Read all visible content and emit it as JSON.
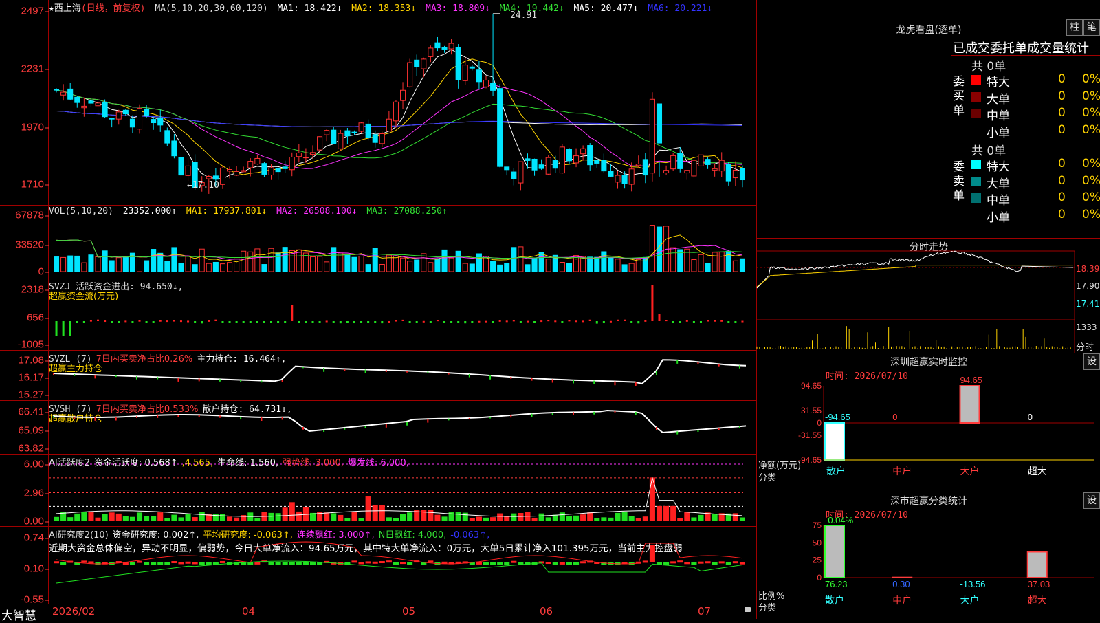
{
  "app": {
    "name": "大智慧"
  },
  "main": {
    "title": "★西上海",
    "period": "(日线，前复权)",
    "ma_label": "MA(5,10,20,30,60,120)",
    "ma": [
      {
        "label": "MA1: 18.422↓",
        "color": "#ffffff"
      },
      {
        "label": "MA2: 18.353↓",
        "color": "#ffd400"
      },
      {
        "label": "MA3: 18.809↓",
        "color": "#ff33ff"
      },
      {
        "label": "MA4: 19.442↓",
        "color": "#33dd33"
      },
      {
        "label": "MA5: 20.477↓",
        "color": "#ffffff"
      },
      {
        "label": "MA6: 20.221↓",
        "color": "#3333ff"
      }
    ],
    "yticks": [
      "2497",
      "2231",
      "1970",
      "1710"
    ],
    "high_label": "24.91",
    "low_label": "←17.10"
  },
  "vol": {
    "label": "VOL(5,10,20)",
    "value": "23352.000↑",
    "ma": [
      {
        "label": "MA1: 17937.801↓",
        "color": "#ffd400"
      },
      {
        "label": "MA2: 26508.100↓",
        "color": "#ff33ff"
      },
      {
        "label": "MA3: 27088.250↑",
        "color": "#33dd33"
      }
    ],
    "yticks": [
      "67878",
      "33520",
      "0"
    ]
  },
  "svzj": {
    "label": "SVZJ  活跃资金进出: 94.650↓,",
    "sub": "超赢资金流(万元)",
    "yticks": [
      "2318",
      "656",
      "-1005"
    ]
  },
  "svzl": {
    "label": "SVZL (7)",
    "red_text": "7日内买卖净占比0.26%",
    "main_text": "主力持仓: 16.464↑,",
    "sub": "超赢主力持仓",
    "yticks": [
      "17.08",
      "16.17",
      "15.27"
    ]
  },
  "svsh": {
    "label": "SVSH (7)",
    "red_text": "7日内买卖净占比0.533%",
    "main_text": "散户持仓: 64.731↓,",
    "sub": "超赢散户持仓",
    "yticks": [
      "66.41",
      "65.09",
      "63.82"
    ]
  },
  "ai1": {
    "label": "AI活跃度2",
    "t1": "资金活跃度: 0.568↑",
    "t2": ",4.565,",
    "t3": "生命线: 1.560,",
    "t4": "强势线: 3.000,",
    "t5": "爆发线: 6.000,",
    "yticks": [
      "6.00",
      "2.96",
      "0.00"
    ]
  },
  "ai2": {
    "label": "AI研究度2(10)",
    "t1": "资金研究度: 0.002↑,",
    "t2": "平均研究度: -0.063↑,",
    "t3": "连续飘红: 3.000↑,",
    "t4": "N日飘红: 4.000,",
    "t5": "-0.063↑,",
    "comment": "近期大资金总体偏空，异动不明显，偏弱势，今日大单净流入：94.65万元，其中特大单净流入：0万元，大单5日累计净入101.395万元，当前主力控盘弱",
    "yticks": [
      "0.74",
      "0.10",
      "-0.55"
    ]
  },
  "xaxis": {
    "labels": [
      "2026/02",
      "04",
      "05",
      "06",
      "07"
    ]
  },
  "dragon": {
    "title": "龙虎看盘(逐单)",
    "btn1": "柱",
    "btn2": "笔",
    "subtitle": "已成交委托单成交量统计",
    "buy_label": "委买单",
    "sell_label": "委卖单",
    "buy_total": "共 0单",
    "sell_total": "共 0单",
    "buy_rows": [
      {
        "name": "特大",
        "count": "0",
        "pct": "0%",
        "color": "#ff0000"
      },
      {
        "name": "大单",
        "count": "0",
        "pct": "0%",
        "color": "#8b0000"
      },
      {
        "name": "中单",
        "count": "0",
        "pct": "0%",
        "color": "#6b0000"
      },
      {
        "name": "小单",
        "count": "0",
        "pct": "0%",
        "color": "#000000"
      }
    ],
    "sell_rows": [
      {
        "name": "特大",
        "count": "0",
        "pct": "0%",
        "color": "#00ffff"
      },
      {
        "name": "大单",
        "count": "0",
        "pct": "0%",
        "color": "#008b8b"
      },
      {
        "name": "中单",
        "count": "0",
        "pct": "0%",
        "color": "#007070"
      },
      {
        "name": "小单",
        "count": "0",
        "pct": "0%",
        "color": "#000000"
      }
    ]
  },
  "intraday": {
    "title": "分时走势",
    "yticks": [
      "18.39",
      "17.90",
      "17.41"
    ],
    "vol_label": "1333",
    "unit_label": "分时"
  },
  "monitor": {
    "title": "深圳超赢实时监控",
    "btn": "设",
    "date": "时间: 2026/07/10",
    "yticks": [
      "94.65",
      "31.55",
      "0",
      "-31.55",
      "-94.65"
    ],
    "top_value": "94.65",
    "values_row": [
      "-94.65",
      "0",
      "",
      "0"
    ],
    "ylabel": "净额(万元)",
    "xlabel": "分类",
    "categories": [
      "散户",
      "中户",
      "大户",
      "超大"
    ]
  },
  "classify": {
    "title": "深市超赢分类统计",
    "btn": "设",
    "date": "时间: 2026/07/10",
    "top_value": "-0.04%",
    "yticks": [
      "75",
      "50",
      "25",
      "0"
    ],
    "ylabel": "比例%",
    "xlabel": "分类",
    "values": [
      "76.23",
      "0.30",
      "-13.56",
      "37.03"
    ],
    "categories": [
      "散户",
      "中户",
      "大户",
      "超大"
    ]
  },
  "chart_data": [
    {
      "type": "bar",
      "title": "深圳超赢实时监控",
      "categories": [
        "散户",
        "中户",
        "大户",
        "超大"
      ],
      "values": [
        -94.65,
        0,
        94.65,
        0
      ],
      "ylabel": "净额(万元)",
      "ylim": [
        -94.65,
        94.65
      ]
    },
    {
      "type": "bar",
      "title": "深市超赢分类统计",
      "categories": [
        "散户",
        "中户",
        "大户",
        "超大"
      ],
      "values": [
        76.23,
        0.3,
        -13.56,
        37.03
      ],
      "ylabel": "比例%",
      "ylim": [
        0,
        75
      ]
    }
  ]
}
